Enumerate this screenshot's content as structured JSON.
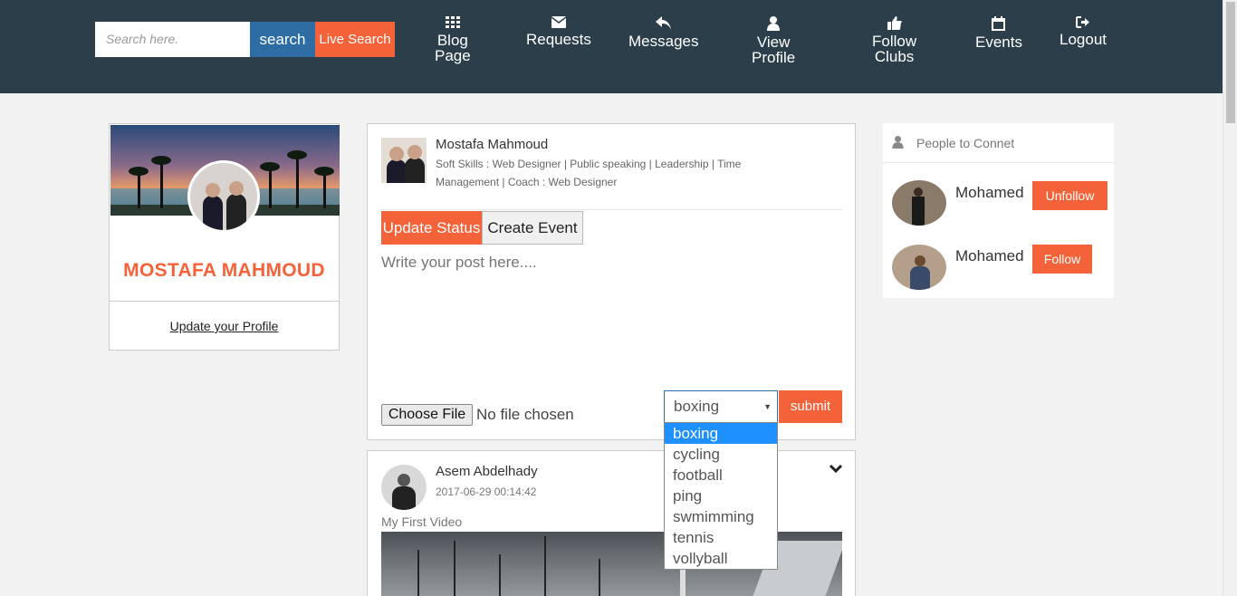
{
  "navbar": {
    "search_placeholder": "Search here.",
    "search_label": "search",
    "live_search_label": "Live Search",
    "items": [
      {
        "label": "Blog\nPage",
        "icon": "grid-icon"
      },
      {
        "label": "Requests",
        "icon": "envelope-icon"
      },
      {
        "label": "Messages",
        "icon": "reply-icon"
      },
      {
        "label": "View\nProfile",
        "icon": "user-icon"
      },
      {
        "label": "Follow\nClubs",
        "icon": "thumbs-up-icon"
      },
      {
        "label": "Events",
        "icon": "calendar-icon"
      },
      {
        "label": "Logout",
        "icon": "logout-icon"
      }
    ]
  },
  "profile": {
    "name": "MOSTAFA MAHMOUD",
    "update_link": "Update your Profile"
  },
  "composer": {
    "author": "Mostafa Mahmoud",
    "skills": "Soft Skills : Web Designer | Public speaking | Leadership | Time Management | Coach : Web Designer",
    "tab_update": "Update Status",
    "tab_event": "Create Event",
    "placeholder": "Write your post here....",
    "choose_file": "Choose File",
    "no_file": "No file chosen",
    "selected_option": "boxing",
    "submit": "submit",
    "options": [
      "boxing",
      "cycling",
      "football",
      "ping",
      "swmimming",
      "tennis",
      "vollyball"
    ]
  },
  "post": {
    "author": "Asem Abdelhady",
    "date": "2017-06-29 00:14:42",
    "title": "My First Video"
  },
  "people": {
    "title": "People to Connet",
    "list": [
      {
        "name": "Mohamed",
        "action": "Unfollow"
      },
      {
        "name": "Mohamed",
        "action": "Follow"
      }
    ]
  },
  "colors": {
    "nav_bg": "#2b3e4a",
    "accent": "#f4623a",
    "search_blue": "#2e6da4"
  }
}
